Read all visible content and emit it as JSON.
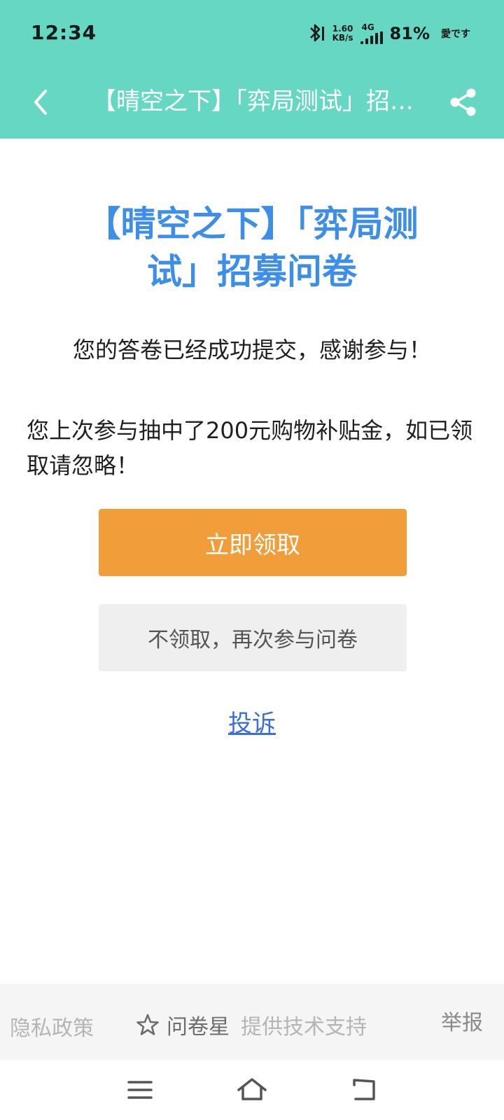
{
  "status_bar": {
    "time": "12:34",
    "net_speed_value": "1.60",
    "net_speed_unit": "KB/s",
    "network_type": "4G",
    "battery": "81%",
    "carrier": "愛です"
  },
  "nav": {
    "title": "【晴空之下】「弈局测试」招募问卷"
  },
  "content": {
    "title": "【晴空之下】「弈局测试」招募问卷",
    "success_message": "您的答卷已经成功提交，感谢参与！",
    "prize_message": "您上次参与抽中了200元购物补贴金，如已领取请忽略！",
    "claim_button": "立即领取",
    "retry_button": "不领取，再次参与问卷",
    "complain_link": "投诉"
  },
  "footer": {
    "privacy": "隐私政策",
    "brand_name": "问卷星",
    "support": "提供技术支持",
    "report": "举报"
  },
  "colors": {
    "header": "#66d7c3",
    "title": "#3d8ee8",
    "claim_button": "#f19e3a",
    "link": "#3a6fd8"
  }
}
